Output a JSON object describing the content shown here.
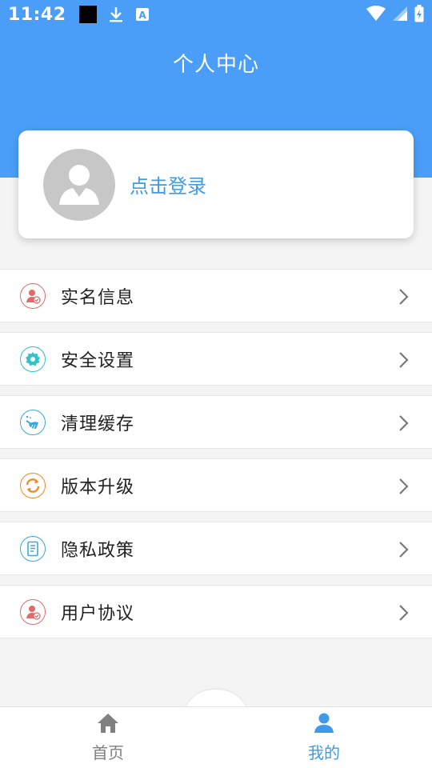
{
  "status_bar": {
    "time": "11:42"
  },
  "header": {
    "title": "个人中心"
  },
  "profile": {
    "login_label": "点击登录"
  },
  "menu": {
    "items": [
      {
        "label": "实名信息",
        "icon": "user-verify-icon",
        "color": "#e06b6b"
      },
      {
        "label": "安全设置",
        "icon": "gear-icon",
        "color": "#2fc3c9"
      },
      {
        "label": "清理缓存",
        "icon": "broom-icon",
        "color": "#3aa8d8"
      },
      {
        "label": "版本升级",
        "icon": "refresh-icon",
        "color": "#f08a24"
      },
      {
        "label": "隐私政策",
        "icon": "document-icon",
        "color": "#3aa8d8"
      },
      {
        "label": "用户协议",
        "icon": "user-verify-icon",
        "color": "#e06b6b"
      }
    ]
  },
  "tabbar": {
    "tabs": [
      {
        "label": "首页",
        "icon": "home-icon",
        "active": false
      },
      {
        "label": "我的",
        "icon": "person-icon",
        "active": true
      }
    ],
    "active_color": "#3d9be9",
    "inactive_color": "#808080"
  },
  "colors": {
    "header": "#4a9ef7",
    "accent": "#3d9be9"
  }
}
